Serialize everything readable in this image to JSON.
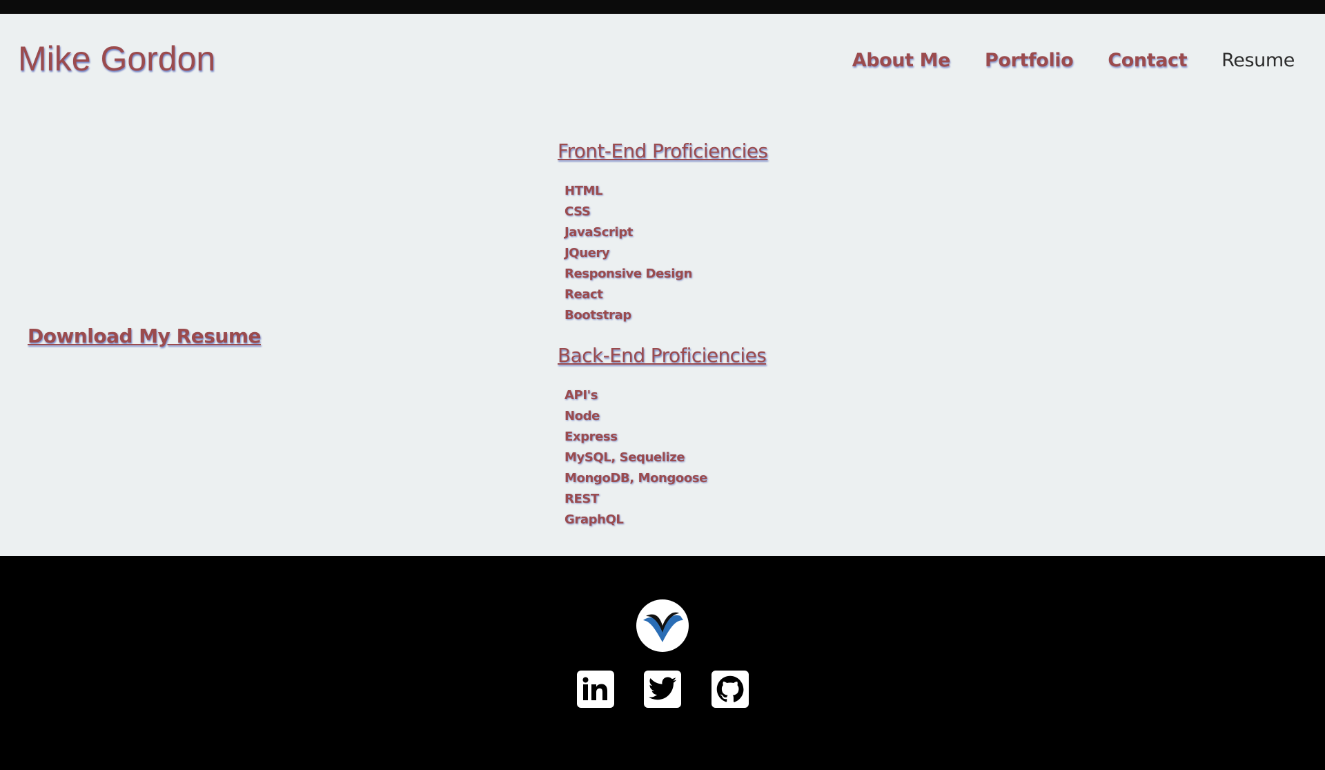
{
  "header": {
    "brand": "Mike Gordon",
    "nav": [
      {
        "label": "About Me",
        "active": false
      },
      {
        "label": "Portfolio",
        "active": false
      },
      {
        "label": "Contact",
        "active": false
      },
      {
        "label": "Resume",
        "active": true
      }
    ]
  },
  "main": {
    "download_label": "Download My Resume",
    "front_end": {
      "title": "Front-End Proficiencies",
      "items": [
        "HTML",
        "CSS",
        "JavaScript",
        "JQuery",
        "Responsive Design",
        "React",
        "Bootstrap"
      ]
    },
    "back_end": {
      "title": "Back-End Proficiencies",
      "items": [
        "API's",
        "Node",
        "Express",
        "MySQL, Sequelize",
        "MongoDB, Mongoose",
        "REST",
        "GraphQL"
      ]
    }
  },
  "footer": {
    "logo_icon": "vimeo-v-logo-icon",
    "social": [
      "linkedin-icon",
      "twitter-icon",
      "github-icon"
    ]
  },
  "colors": {
    "background": "#ecf0f1",
    "accent": "#9b4b4d",
    "text_shadow": "#465ab4",
    "footer": "#000000",
    "top_bar": "#0b0b0b",
    "logo_blue": "#2a6db5"
  }
}
